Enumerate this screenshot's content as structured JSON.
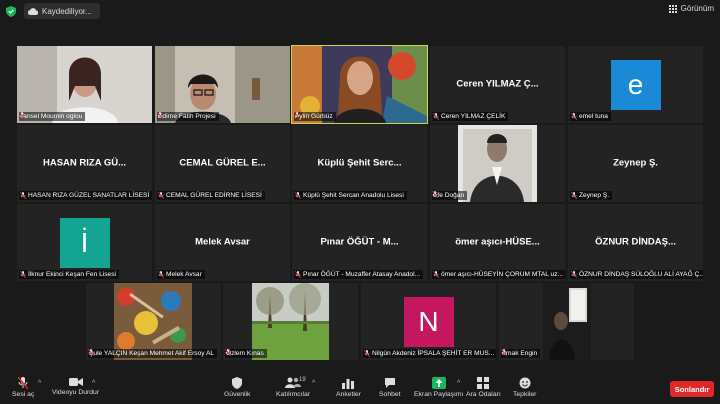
{
  "topbar": {
    "saving_label": "Kaydediliyor...",
    "view_label": "Görünüm"
  },
  "tiles": [
    {
      "type": "video",
      "caption": "Tansel Moumin oglou",
      "scene": "woman-white"
    },
    {
      "type": "video",
      "caption": "Edirne Fatih Projesi",
      "scene": "woman-glasses"
    },
    {
      "type": "video",
      "caption": "Aylin Gürbüz",
      "scene": "woman-art",
      "active": true
    },
    {
      "type": "name",
      "name": "Ceren YILMAZ Ç...",
      "caption": "Ceren YILMAZ ÇELİK"
    },
    {
      "type": "avatar",
      "letter": "e",
      "color": "#1a8ad6",
      "caption": "emel tuna"
    },
    {
      "type": "name",
      "name": "HASAN RIZA GÜ...",
      "caption": "HASAN RIZA GÜZEL SANATLAR LİSESİ"
    },
    {
      "type": "name",
      "name": "CEMAL GÜREL E...",
      "caption": "CEMAL GÜREL EDİRNE LİSESİ"
    },
    {
      "type": "name",
      "name": "Küplü Şehit Serc...",
      "caption": "Küplü Şehit Sercan Anadolu Lisesi"
    },
    {
      "type": "video",
      "caption": "Efe Doğan",
      "scene": "man-photo"
    },
    {
      "type": "name",
      "name": "Zeynep Ş.",
      "caption": "Zeynep Ş."
    },
    {
      "type": "avatar",
      "letter": "İ",
      "color": "#13a591",
      "caption": "İlknur Ekinci Keşan Fen Lisesi"
    },
    {
      "type": "name",
      "name": "Melek Avsar",
      "caption": "Melek Avsar"
    },
    {
      "type": "name",
      "name": "Pınar ÖĞÜT - M...",
      "caption": "Pınar ÖĞÜT - Muzaffer Atasay Anadol..."
    },
    {
      "type": "name",
      "name": "ömer aşıcı-HÜSE...",
      "caption": "ömer aşıcı-HÜSEYİN ÇORUM MTAL uz..."
    },
    {
      "type": "name",
      "name": "ÖZNUR DİNDAŞ...",
      "caption": "ÖZNUR DİNDAŞ SÜLOĞLU ALİ AYAĞ Ç..."
    },
    {
      "type": "video",
      "caption": "Şule YALÇIN Keşan Mehmet Akif Ersoy AL",
      "scene": "paints"
    },
    {
      "type": "video",
      "caption": "Özlem Kınas",
      "scene": "garden"
    },
    {
      "type": "avatar",
      "letter": "N",
      "color": "#c4175f",
      "caption": "Nilgün Akdeniz İPSALA ŞEHİT ER MUS..."
    },
    {
      "type": "video",
      "caption": "Irmak Engin",
      "scene": "dark-room"
    }
  ],
  "toolbar": {
    "mute_label": "Sesi aç",
    "video_label": "Videoyu Durdur",
    "security_label": "Güvenlik",
    "participants_label": "Katılımcılar",
    "participants_count": "19",
    "polls_label": "Anketler",
    "chat_label": "Sohbet",
    "share_label": "Ekran Paylaşımı",
    "breakout_label": "Ara Odaları",
    "reactions_label": "Tepkiler",
    "end_label": "Sonlandır"
  },
  "colors": {
    "active_border": "#c9d94a",
    "share_green": "#1bb55c",
    "end_red": "#e02828"
  }
}
